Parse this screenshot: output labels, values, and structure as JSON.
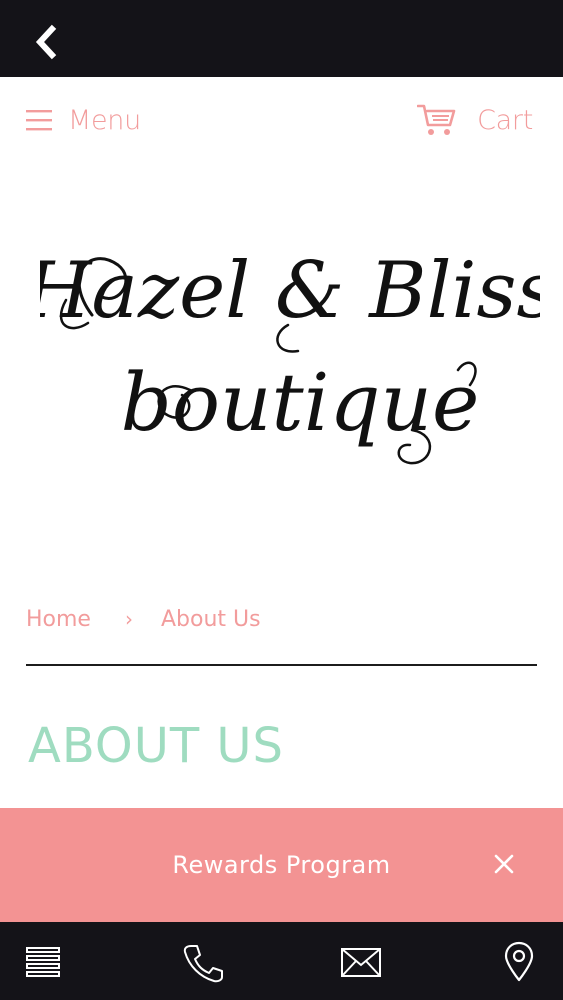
{
  "top_bar": {
    "back_icon": "chevron-left-icon"
  },
  "header": {
    "menu_label": "Menu",
    "menu_icon": "hamburger-icon",
    "cart_label": "Cart",
    "cart_icon": "cart-icon"
  },
  "logo": {
    "line1": "Hazel & Bliss",
    "line2": "boutique"
  },
  "breadcrumb": {
    "home": "Home",
    "separator": "›",
    "current": "About Us"
  },
  "page": {
    "title": "ABOUT US"
  },
  "rewards": {
    "label": "Rewards Program",
    "close_icon": "close-icon"
  },
  "bottom_nav": {
    "items": [
      "list-icon",
      "phone-icon",
      "mail-icon",
      "location-pin-icon"
    ]
  },
  "colors": {
    "bar_dark": "#141318",
    "accent_pink": "#f29c9c",
    "title_mint": "#9fdcc0",
    "rewards_bg": "#f39393"
  }
}
